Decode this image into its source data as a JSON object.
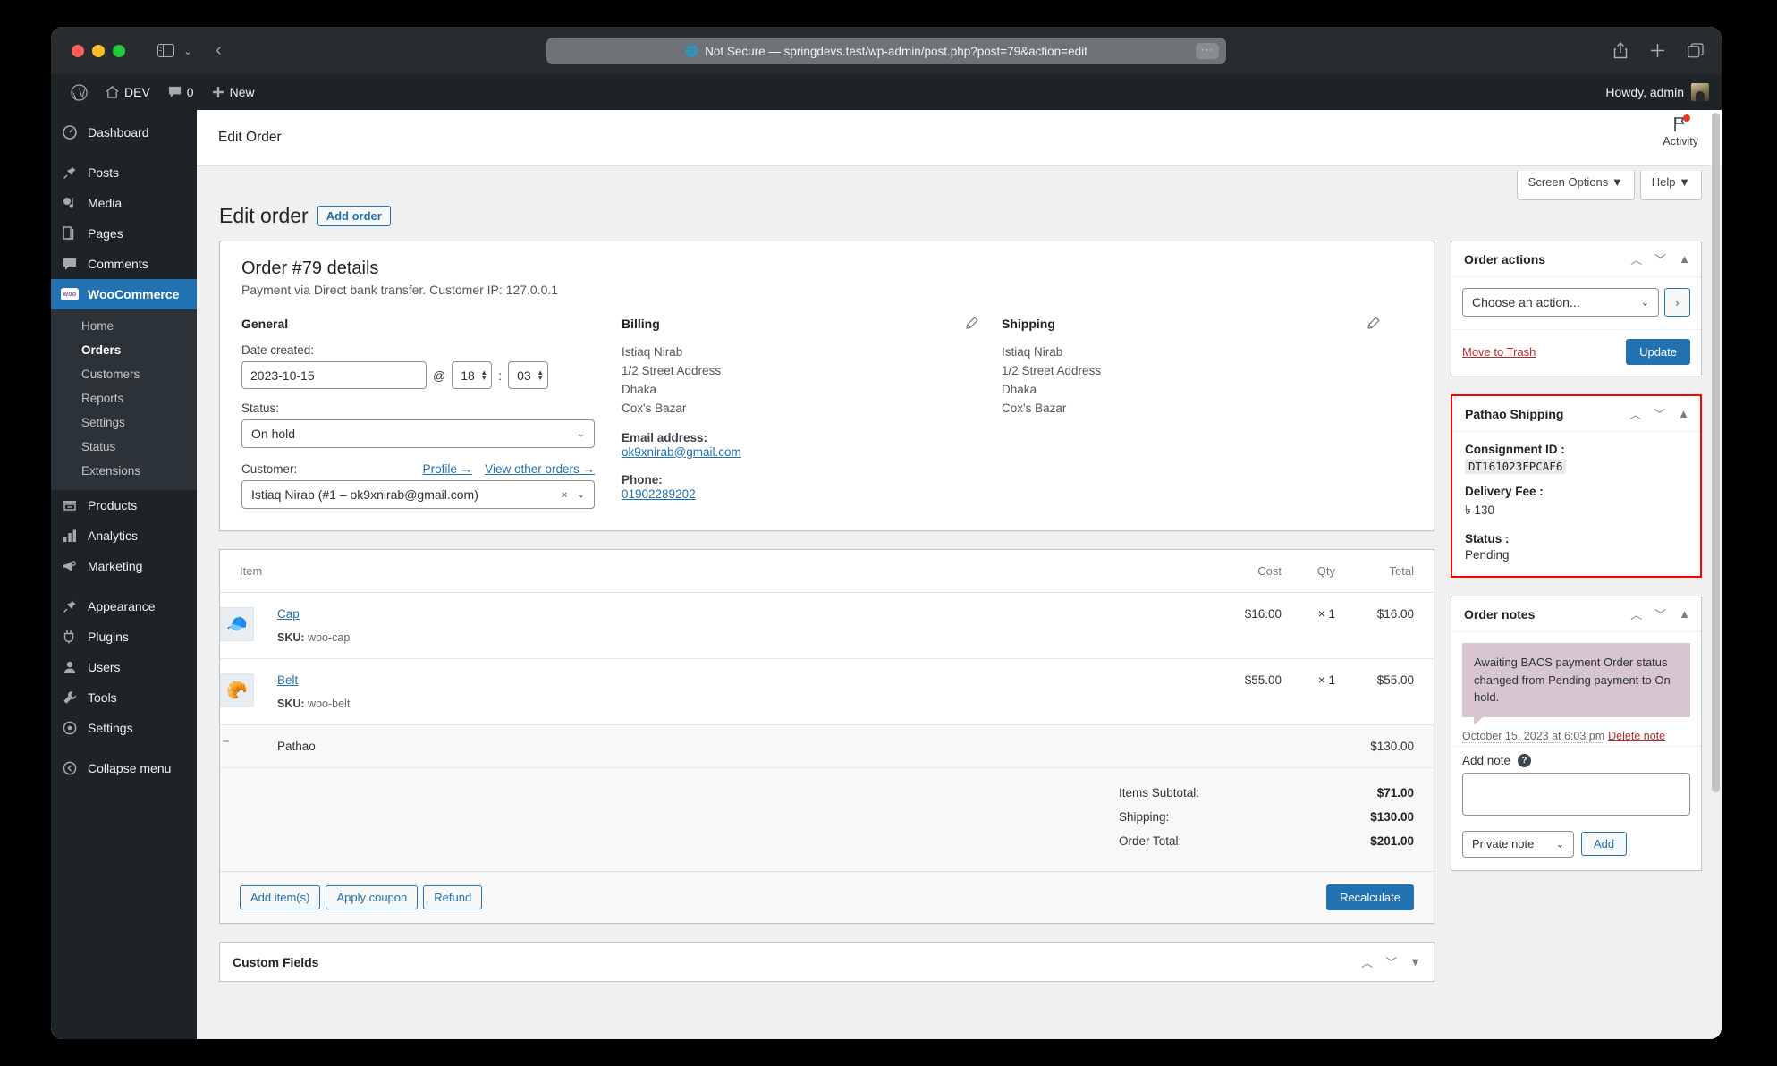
{
  "browser": {
    "url_text": "Not Secure — springdevs.test/wp-admin/post.php?post=79&action=edit",
    "more_label": "···",
    "globe_icon": "globe-icon",
    "share_icon": "share-icon",
    "new_tab_icon": "plus-icon",
    "tabs_icon": "tab-overview-icon",
    "sidebar_icon": "sidebar-toggle-icon",
    "back_icon": "back-chevron-icon"
  },
  "adminbar": {
    "wp_logo": "wordpress-logo-icon",
    "site_name": "DEV",
    "comments_count": "0",
    "new_label": "New",
    "howdy": "Howdy, admin"
  },
  "sidebar": {
    "items": [
      {
        "label": "Dashboard",
        "icon": "dashboard-icon"
      },
      {
        "label": "Posts",
        "icon": "pin-icon"
      },
      {
        "label": "Media",
        "icon": "media-icon"
      },
      {
        "label": "Pages",
        "icon": "pages-icon"
      },
      {
        "label": "Comments",
        "icon": "comment-icon"
      },
      {
        "label": "WooCommerce",
        "icon": "woocommerce-icon"
      },
      {
        "label": "Products",
        "icon": "products-icon"
      },
      {
        "label": "Analytics",
        "icon": "analytics-icon"
      },
      {
        "label": "Marketing",
        "icon": "marketing-icon"
      },
      {
        "label": "Appearance",
        "icon": "appearance-icon"
      },
      {
        "label": "Plugins",
        "icon": "plugins-icon"
      },
      {
        "label": "Users",
        "icon": "users-icon"
      },
      {
        "label": "Tools",
        "icon": "tools-icon"
      },
      {
        "label": "Settings",
        "icon": "settings-icon"
      },
      {
        "label": "Collapse menu",
        "icon": "collapse-icon"
      }
    ],
    "woocommerce_submenu": [
      {
        "label": "Home",
        "current": false
      },
      {
        "label": "Orders",
        "current": true
      },
      {
        "label": "Customers",
        "current": false
      },
      {
        "label": "Reports",
        "current": false
      },
      {
        "label": "Settings",
        "current": false
      },
      {
        "label": "Status",
        "current": false
      },
      {
        "label": "Extensions",
        "current": false
      }
    ]
  },
  "page": {
    "header_title": "Edit Order",
    "activity_label": "Activity",
    "screen_options_label": "Screen Options",
    "help_label": "Help",
    "title": "Edit order",
    "add_order_label": "Add order"
  },
  "order": {
    "heading": "Order #79 details",
    "subheading": "Payment via Direct bank transfer. Customer IP: 127.0.0.1",
    "general": {
      "title": "General",
      "date_label": "Date created:",
      "date_value": "2023-10-15",
      "at_symbol": "@",
      "hour_value": "18",
      "colon": ":",
      "minute_value": "03",
      "status_label": "Status:",
      "status_value": "On hold",
      "customer_label": "Customer:",
      "profile_link": "Profile →",
      "view_orders_link": "View other orders →",
      "customer_value": "Istiaq Nirab (#1 – ok9xnirab@gmail.com)"
    },
    "billing": {
      "title": "Billing",
      "address_lines": [
        "Istiaq Nirab",
        "1/2 Street Address",
        "Dhaka",
        "Cox's Bazar"
      ],
      "email_label": "Email address:",
      "email_value": "ok9xnirab@gmail.com",
      "phone_label": "Phone:",
      "phone_value": "01902289202",
      "edit_icon": "pencil-icon"
    },
    "shipping": {
      "title": "Shipping",
      "address_lines": [
        "Istiaq Nirab",
        "1/2 Street Address",
        "Dhaka",
        "Cox's Bazar"
      ],
      "edit_icon": "pencil-icon"
    }
  },
  "items": {
    "columns": {
      "item": "Item",
      "cost": "Cost",
      "qty": "Qty",
      "total": "Total"
    },
    "rows": [
      {
        "name": "Cap",
        "sku_label": "SKU:",
        "sku": "woo-cap",
        "cost": "$16.00",
        "qty": "× 1",
        "total": "$16.00",
        "thumb": "🧢"
      },
      {
        "name": "Belt",
        "sku_label": "SKU:",
        "sku": "woo-belt",
        "cost": "$55.00",
        "qty": "× 1",
        "total": "$55.00",
        "thumb": "🥐"
      }
    ],
    "shipping_row": {
      "name": "Pathao",
      "total": "$130.00",
      "icon": "truck-icon"
    },
    "totals": [
      {
        "label": "Items Subtotal:",
        "value": "$71.00"
      },
      {
        "label": "Shipping:",
        "value": "$130.00"
      },
      {
        "label": "Order Total:",
        "value": "$201.00"
      }
    ],
    "actions": {
      "add_items": "Add item(s)",
      "apply_coupon": "Apply coupon",
      "refund": "Refund",
      "recalculate": "Recalculate"
    }
  },
  "order_actions": {
    "title": "Order actions",
    "select_value": "Choose an action...",
    "go_label": "›",
    "trash_label": "Move to Trash",
    "update_label": "Update"
  },
  "pathao": {
    "title": "Pathao Shipping",
    "consignment_label": "Consignment ID :",
    "consignment_value": "DT161023FPCAF6",
    "fee_label": "Delivery Fee :",
    "fee_value": "৳ 130",
    "status_label": "Status :",
    "status_value": "Pending",
    "border_color": "#ff0000"
  },
  "order_notes": {
    "title": "Order notes",
    "notes": [
      {
        "text": "Awaiting BACS payment Order status changed from Pending payment to On hold.",
        "date": "October 15, 2023 at 6:03 pm",
        "delete_label": "Delete note"
      }
    ],
    "add_note_label": "Add note",
    "note_value": "",
    "note_type": "Private note",
    "add_label": "Add"
  },
  "custom_fields": {
    "title": "Custom Fields"
  },
  "icons": {
    "collapse_caret": "▲",
    "up_caret": "︿",
    "down_caret": "﹀",
    "chevron_down": "⌄"
  }
}
